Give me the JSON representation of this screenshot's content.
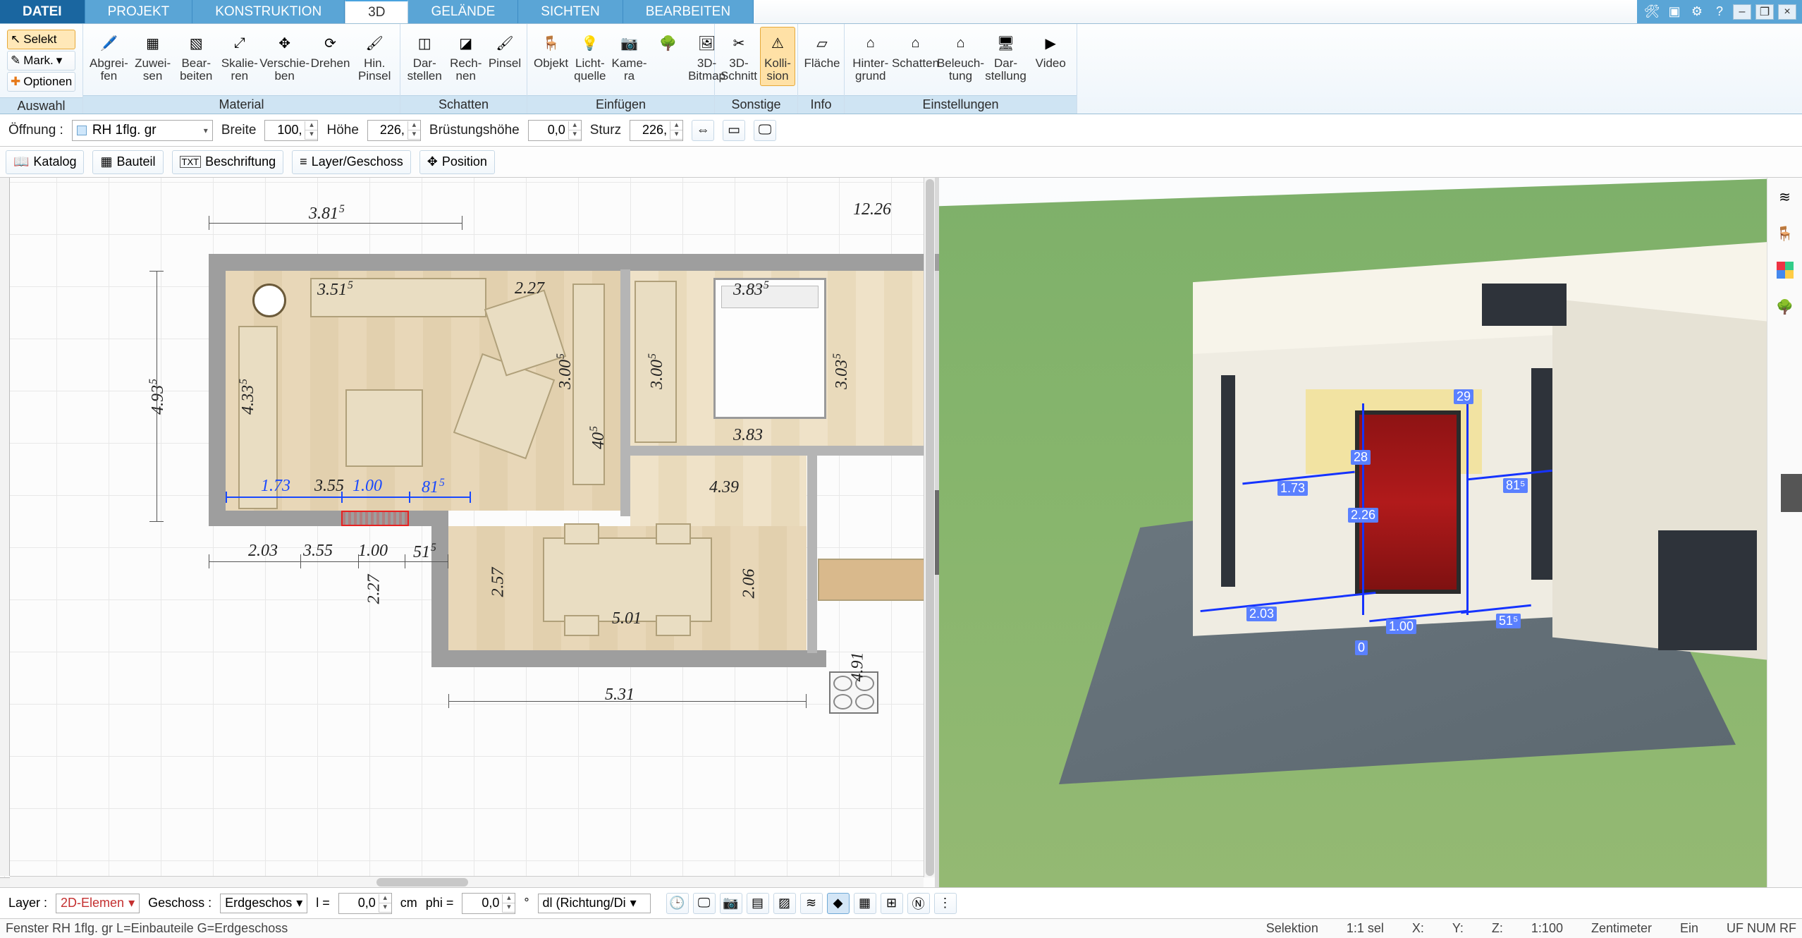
{
  "tabs": {
    "datei": "DATEI",
    "projekt": "PROJEKT",
    "konstruktion": "KONSTRUKTION",
    "d3": "3D",
    "gelaende": "GELÄNDE",
    "sichten": "SICHTEN",
    "bearbeiten": "BEARBEITEN"
  },
  "auswahl": {
    "selekt": "Selekt",
    "mark": "Mark.",
    "optionen": "Optionen",
    "label": "Auswahl"
  },
  "ribbon": {
    "material": {
      "label": "Material",
      "abgreifen": "Abgrei-\nfen",
      "zuweisen": "Zuwei-\nsen",
      "bearbeiten": "Bear-\nbeiten",
      "skalieren": "Skalie-\nren",
      "verschieben": "Verschie-\nben",
      "drehen": "Drehen",
      "hinpinsel": "Hin.\nPinsel"
    },
    "schatten": {
      "label": "Schatten",
      "darstellen": "Dar-\nstellen",
      "rechnen": "Rech-\nnen",
      "pinsel": "Pinsel"
    },
    "einfuegen": {
      "label": "Einfügen",
      "objekt": "Objekt",
      "lichtquelle": "Licht-\nquelle",
      "kamera": "Kame-\nra",
      "d3bitmap": "3D-\nBitmap",
      "baum": ""
    },
    "sonstige": {
      "label": "Sonstige",
      "d3schnitt": "3D-\nSchnitt",
      "kollision": "Kolli-\nsion"
    },
    "info": {
      "label": "Info",
      "flaeche": "Fläche"
    },
    "einstellungen": {
      "label": "Einstellungen",
      "hintergrund": "Hinter-\ngrund",
      "schatten": "Schatten",
      "beleuchtung": "Beleuch-\ntung",
      "darstellung": "Dar-\nstellung",
      "video": "Video"
    }
  },
  "params": {
    "oeffnung_label": "Öffnung :",
    "oeffnung_value": "RH 1flg. gr",
    "breite_label": "Breite",
    "breite_value": "100,",
    "hoehe_label": "Höhe",
    "hoehe_value": "226,",
    "bruestung_label": "Brüstungshöhe",
    "bruestung_value": "0,0",
    "sturz_label": "Sturz",
    "sturz_value": "226,"
  },
  "toolbar2": {
    "katalog": "Katalog",
    "bauteil": "Bauteil",
    "beschriftung": "Beschriftung",
    "layergeschoss": "Layer/Geschoss",
    "position": "Position"
  },
  "plan_dims": {
    "d381": "3.81",
    "d1226": "12.26",
    "d351": "3.51",
    "d227a": "2.27",
    "d383a": "3.83",
    "d493": "4.93",
    "d433": "4.33",
    "d300a": "3.00",
    "d300b": "3.00",
    "d303": "3.03",
    "d40": "40",
    "d173": "1.73",
    "d355": "3.55",
    "d100": "1.00",
    "d81": "81",
    "d439": "4.39",
    "d383b": "3.83",
    "d203": "2.03",
    "d355b": "3.55",
    "d100b": "1.00",
    "d51": "51",
    "d227b": "2.27",
    "d257": "2.57",
    "d501": "5.01",
    "d206": "2.06",
    "d531": "5.31",
    "d491": "4.91"
  },
  "labels3d": {
    "d203": "2.03",
    "d100": "1.00",
    "d51": "51⁵",
    "d173": "1.73",
    "d81": "81⁵",
    "d226": "2.26",
    "d29": "29",
    "d28": "28",
    "d0": "0"
  },
  "bottom": {
    "layer_label": "Layer :",
    "layer_value": "2D-Elemen",
    "geschoss_label": "Geschoss :",
    "geschoss_value": "Erdgeschos",
    "l_label": "l =",
    "l_value": "0,0",
    "cm": "cm",
    "phi_label": "phi =",
    "phi_value": "0,0",
    "deg": "°",
    "dl_value": "dl (Richtung/Di"
  },
  "status": {
    "left": "Fenster RH 1flg. gr L=Einbauteile G=Erdgeschoss",
    "selektion": "Selektion",
    "selcount": "1:1 sel",
    "x": "X:",
    "y": "Y:",
    "z": "Z:",
    "scale": "1:100",
    "unit": "Zentimeter",
    "ein": "Ein",
    "numrf": "UF NUM RF"
  }
}
